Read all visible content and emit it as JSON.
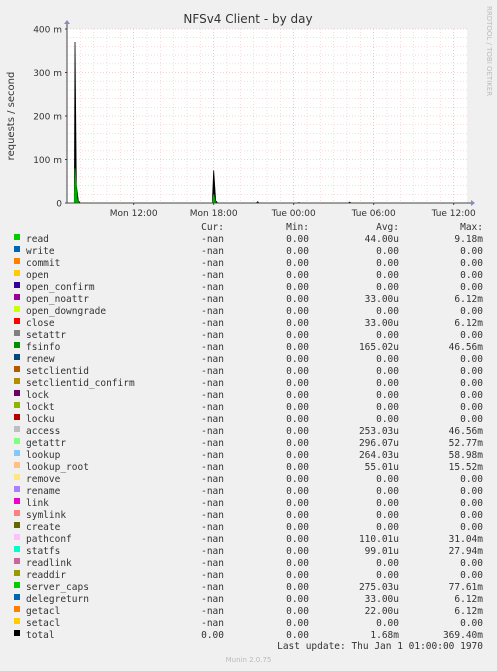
{
  "chart_data": {
    "type": "area",
    "title": "NFSv4 Client - by day",
    "ylabel": "requests / second",
    "xlabel": "",
    "ylim": [
      0,
      400
    ],
    "y_ticks": [
      {
        "value": 0,
        "label": "0"
      },
      {
        "value": 100,
        "label": "100 m"
      },
      {
        "value": 200,
        "label": "200 m"
      },
      {
        "value": 300,
        "label": "300 m"
      },
      {
        "value": 400,
        "label": "400 m"
      }
    ],
    "y_unit_scale": "milli (m)",
    "x_range_hours": [
      0,
      30
    ],
    "x_ticks": [
      {
        "hour": 5,
        "label": "Mon 12:00"
      },
      {
        "hour": 11,
        "label": "Mon 18:00"
      },
      {
        "hour": 17,
        "label": "Tue 00:00"
      },
      {
        "hour": 23,
        "label": "Tue 06:00"
      },
      {
        "hour": 29,
        "label": "Tue 12:00"
      }
    ],
    "grid": true,
    "series": [
      {
        "name": "total",
        "color": "#000000",
        "points": [
          [
            0,
            0
          ],
          [
            0.55,
            0
          ],
          [
            0.6,
            370
          ],
          [
            0.7,
            40
          ],
          [
            0.85,
            5
          ],
          [
            1.0,
            0
          ],
          [
            10.9,
            0
          ],
          [
            11.0,
            75
          ],
          [
            11.15,
            5
          ],
          [
            11.3,
            0
          ],
          [
            14.2,
            0
          ],
          [
            14.3,
            3
          ],
          [
            14.4,
            0
          ],
          [
            17.3,
            0
          ],
          [
            17.4,
            1
          ],
          [
            17.5,
            0
          ],
          [
            21.1,
            0
          ],
          [
            21.2,
            2
          ],
          [
            21.3,
            0
          ],
          [
            30,
            0
          ]
        ]
      },
      {
        "name": "getattr",
        "color": "#00aa00",
        "points": [
          [
            0,
            0
          ],
          [
            0.55,
            0
          ],
          [
            0.6,
            80
          ],
          [
            0.75,
            10
          ],
          [
            0.9,
            0
          ],
          [
            10.9,
            0
          ],
          [
            11.0,
            20
          ],
          [
            11.15,
            0
          ],
          [
            30,
            0
          ]
        ]
      }
    ]
  },
  "legend_header": {
    "cur": "Cur:",
    "min": "Min:",
    "avg": "Avg:",
    "max": "Max:"
  },
  "legend": [
    {
      "name": "read",
      "color": "#00cc00",
      "cur": "-nan",
      "min": "0.00",
      "avg": "44.00u",
      "max": "9.18m"
    },
    {
      "name": "write",
      "color": "#0066b3",
      "cur": "-nan",
      "min": "0.00",
      "avg": "0.00",
      "max": "0.00"
    },
    {
      "name": "commit",
      "color": "#ff8000",
      "cur": "-nan",
      "min": "0.00",
      "avg": "0.00",
      "max": "0.00"
    },
    {
      "name": "open",
      "color": "#ffcc00",
      "cur": "-nan",
      "min": "0.00",
      "avg": "0.00",
      "max": "0.00"
    },
    {
      "name": "open_confirm",
      "color": "#330099",
      "cur": "-nan",
      "min": "0.00",
      "avg": "0.00",
      "max": "0.00"
    },
    {
      "name": "open_noattr",
      "color": "#990099",
      "cur": "-nan",
      "min": "0.00",
      "avg": "33.00u",
      "max": "6.12m"
    },
    {
      "name": "open_downgrade",
      "color": "#ccff00",
      "cur": "-nan",
      "min": "0.00",
      "avg": "0.00",
      "max": "0.00"
    },
    {
      "name": "close",
      "color": "#ff0000",
      "cur": "-nan",
      "min": "0.00",
      "avg": "33.00u",
      "max": "6.12m"
    },
    {
      "name": "setattr",
      "color": "#808080",
      "cur": "-nan",
      "min": "0.00",
      "avg": "0.00",
      "max": "0.00"
    },
    {
      "name": "fsinfo",
      "color": "#008f00",
      "cur": "-nan",
      "min": "0.00",
      "avg": "165.02u",
      "max": "46.56m"
    },
    {
      "name": "renew",
      "color": "#00487d",
      "cur": "-nan",
      "min": "0.00",
      "avg": "0.00",
      "max": "0.00"
    },
    {
      "name": "setclientid",
      "color": "#b35a00",
      "cur": "-nan",
      "min": "0.00",
      "avg": "0.00",
      "max": "0.00"
    },
    {
      "name": "setclientid_confirm",
      "color": "#b38f00",
      "cur": "-nan",
      "min": "0.00",
      "avg": "0.00",
      "max": "0.00"
    },
    {
      "name": "lock",
      "color": "#6b006b",
      "cur": "-nan",
      "min": "0.00",
      "avg": "0.00",
      "max": "0.00"
    },
    {
      "name": "lockt",
      "color": "#8fb300",
      "cur": "-nan",
      "min": "0.00",
      "avg": "0.00",
      "max": "0.00"
    },
    {
      "name": "locku",
      "color": "#b30000",
      "cur": "-nan",
      "min": "0.00",
      "avg": "0.00",
      "max": "0.00"
    },
    {
      "name": "access",
      "color": "#bebebe",
      "cur": "-nan",
      "min": "0.00",
      "avg": "253.03u",
      "max": "46.56m"
    },
    {
      "name": "getattr",
      "color": "#80ff80",
      "cur": "-nan",
      "min": "0.00",
      "avg": "296.07u",
      "max": "52.77m"
    },
    {
      "name": "lookup",
      "color": "#80c9ff",
      "cur": "-nan",
      "min": "0.00",
      "avg": "264.03u",
      "max": "58.98m"
    },
    {
      "name": "lookup_root",
      "color": "#ffc080",
      "cur": "-nan",
      "min": "0.00",
      "avg": "55.01u",
      "max": "15.52m"
    },
    {
      "name": "remove",
      "color": "#ffe680",
      "cur": "-nan",
      "min": "0.00",
      "avg": "0.00",
      "max": "0.00"
    },
    {
      "name": "rename",
      "color": "#aa80ff",
      "cur": "-nan",
      "min": "0.00",
      "avg": "0.00",
      "max": "0.00"
    },
    {
      "name": "link",
      "color": "#ee00cc",
      "cur": "-nan",
      "min": "0.00",
      "avg": "0.00",
      "max": "0.00"
    },
    {
      "name": "symlink",
      "color": "#ff8080",
      "cur": "-nan",
      "min": "0.00",
      "avg": "0.00",
      "max": "0.00"
    },
    {
      "name": "create",
      "color": "#666600",
      "cur": "-nan",
      "min": "0.00",
      "avg": "0.00",
      "max": "0.00"
    },
    {
      "name": "pathconf",
      "color": "#ffbfff",
      "cur": "-nan",
      "min": "0.00",
      "avg": "110.01u",
      "max": "31.04m"
    },
    {
      "name": "statfs",
      "color": "#00ffcc",
      "cur": "-nan",
      "min": "0.00",
      "avg": "99.01u",
      "max": "27.94m"
    },
    {
      "name": "readlink",
      "color": "#cc6699",
      "cur": "-nan",
      "min": "0.00",
      "avg": "0.00",
      "max": "0.00"
    },
    {
      "name": "readdir",
      "color": "#999900",
      "cur": "-nan",
      "min": "0.00",
      "avg": "0.00",
      "max": "0.00"
    },
    {
      "name": "server_caps",
      "color": "#00cc00",
      "cur": "-nan",
      "min": "0.00",
      "avg": "275.03u",
      "max": "77.61m"
    },
    {
      "name": "delegreturn",
      "color": "#0066b3",
      "cur": "-nan",
      "min": "0.00",
      "avg": "33.00u",
      "max": "6.12m"
    },
    {
      "name": "getacl",
      "color": "#ff8000",
      "cur": "-nan",
      "min": "0.00",
      "avg": "22.00u",
      "max": "6.12m"
    },
    {
      "name": "setacl",
      "color": "#ffcc00",
      "cur": "-nan",
      "min": "0.00",
      "avg": "0.00",
      "max": "0.00"
    },
    {
      "name": "total",
      "color": "#000000",
      "cur": "0.00",
      "min": "0.00",
      "avg": "1.68m",
      "max": "369.40m"
    }
  ],
  "footer": {
    "last_update": "Last update: Thu Jan  1 01:00:00 1970",
    "munin_version": "Munin 2.0.75",
    "rrd_credit": "RRDTOOL / TOBI OETIKER"
  },
  "colors": {
    "background": "#f0f0f0",
    "plot_area": "#ffffff",
    "grid_major": "#e3a3a3",
    "grid_minor": "#f0c8c8"
  }
}
